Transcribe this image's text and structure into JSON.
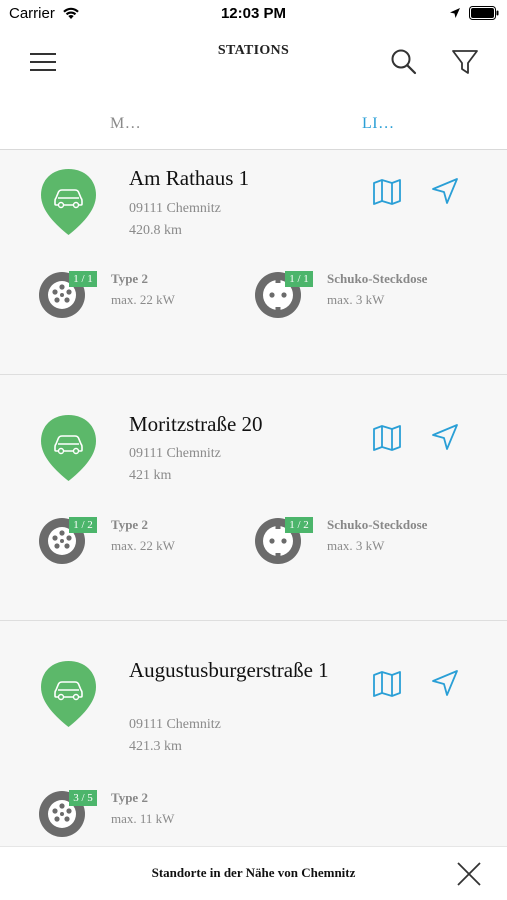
{
  "status_bar": {
    "carrier": "Carrier",
    "time": "12:03 PM"
  },
  "nav": {
    "title": "STATIONS",
    "menu_icon": "hamburger-menu-icon",
    "search_icon": "search-icon",
    "filter_icon": "filter-icon"
  },
  "tabs": [
    {
      "label": "M…",
      "selected": false
    },
    {
      "label": "LI…",
      "selected": true
    }
  ],
  "colors": {
    "accent": "#2a9fd6",
    "available": "#4cb56b",
    "pin": "#5cb86a",
    "connector": "#6b6b6b"
  },
  "stations": [
    {
      "name": "Am Rathaus 1",
      "city": "09111 Chemnitz",
      "distance": "420.8 km",
      "connectors": [
        {
          "availability": "1 / 1",
          "type": "Type 2",
          "power": "max. 22 kW",
          "icon": "type2-plug-icon"
        },
        {
          "availability": "1 / 1",
          "type": "Schuko-Steckdose",
          "power": "max. 3 kW",
          "icon": "schuko-socket-icon"
        }
      ]
    },
    {
      "name": "Moritzstraße 20",
      "city": "09111 Chemnitz",
      "distance": "421 km",
      "connectors": [
        {
          "availability": "1 / 2",
          "type": "Type 2",
          "power": "max. 22 kW",
          "icon": "type2-plug-icon"
        },
        {
          "availability": "1 / 2",
          "type": "Schuko-Steckdose",
          "power": "max. 3 kW",
          "icon": "schuko-socket-icon"
        }
      ]
    },
    {
      "name": "Augustusburgerstraße 1",
      "city": "09111 Chemnitz",
      "distance": "421.3 km",
      "connectors": [
        {
          "availability": "3 / 5",
          "type": "Type 2",
          "power": "max. 11 kW",
          "icon": "type2-plug-icon"
        }
      ]
    }
  ],
  "bottom_bar": {
    "text": "Standorte in der Nähe von Chemnitz",
    "close_icon": "close-icon"
  }
}
